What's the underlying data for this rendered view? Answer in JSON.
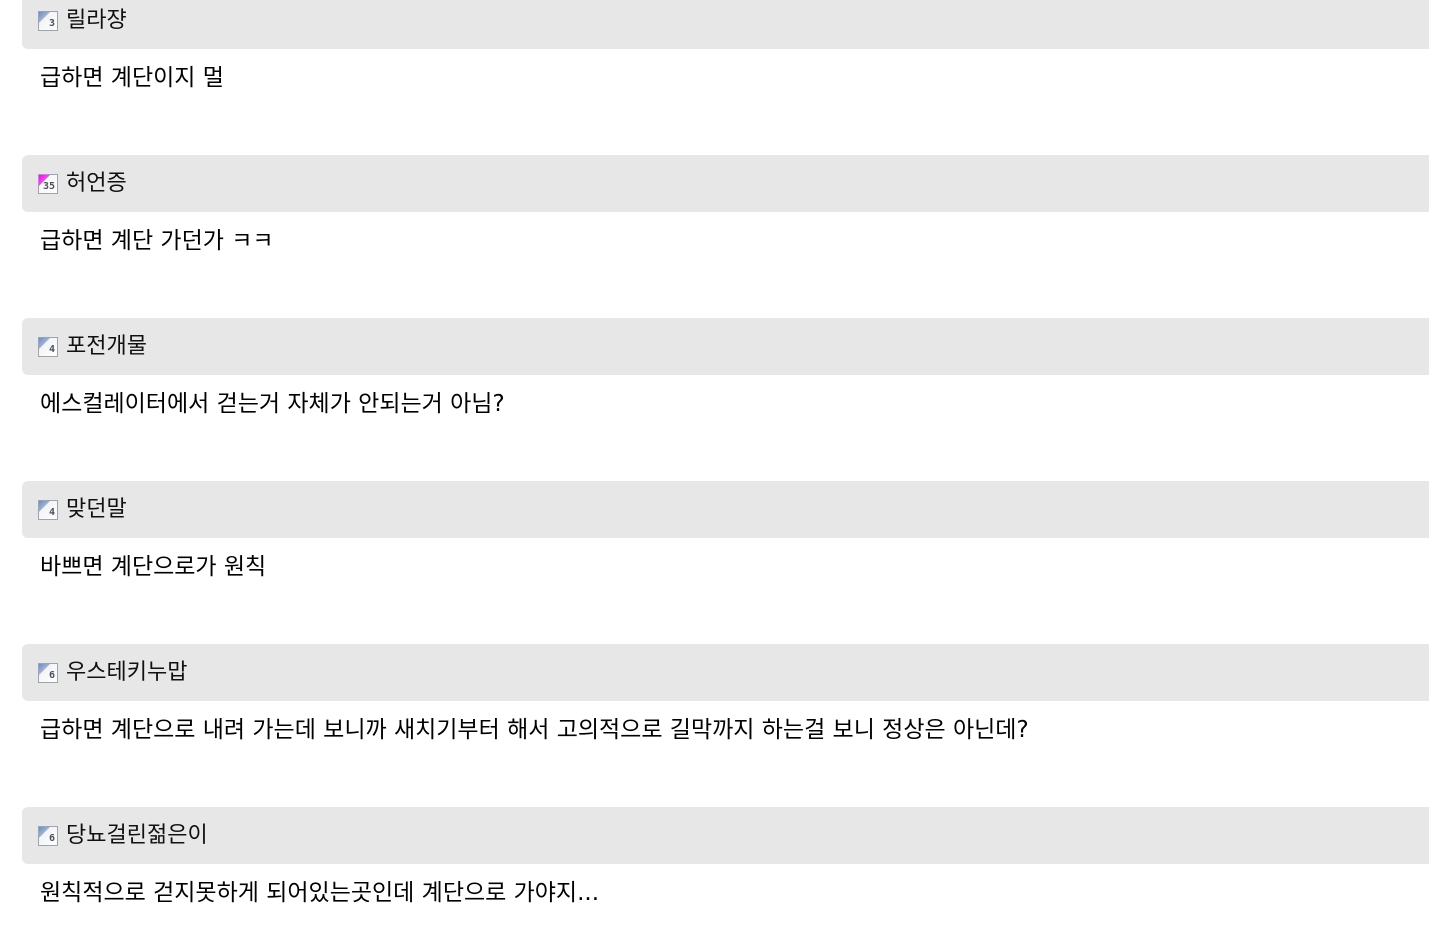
{
  "comments": [
    {
      "nickname": "릴라쟝",
      "level": "3",
      "icon": "level-badge-icon",
      "text": "급하면 계단이지 멀"
    },
    {
      "nickname": "허언증",
      "level": "35",
      "icon": "level-badge-icon",
      "icon_color": "#ff33ff",
      "text": "급하면 계단 가던가 ㅋㅋ"
    },
    {
      "nickname": "포전개물",
      "level": "4",
      "icon": "level-badge-icon",
      "text": "에스컬레이터에서 걷는거 자체가 안되는거 아님?"
    },
    {
      "nickname": "맞던말",
      "level": "4",
      "icon": "level-badge-icon",
      "text": "바쁘면 계단으로가 원칙"
    },
    {
      "nickname": "우스테키누맙",
      "level": "6",
      "icon": "level-badge-icon",
      "text": "급하면 계단으로 내려 가는데 보니까 새치기부터 해서 고의적으로 길막까지 하는걸 보니 정상은 아닌데?"
    },
    {
      "nickname": "당뇨걸린젊은이",
      "level": "6",
      "icon": "level-badge-icon",
      "text": "원칙적으로 걷지못하게 되어있는곳인데 계단으로 가야지..."
    }
  ],
  "colors": {
    "header_background": "#e7e7e7",
    "page_background": "#ffffff"
  }
}
